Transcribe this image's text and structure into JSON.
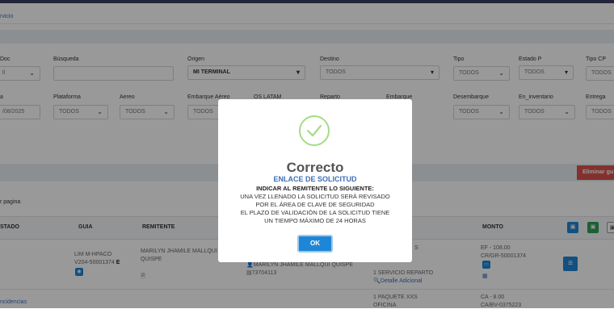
{
  "breadcrumb": "rvicio",
  "filters": {
    "row1": [
      {
        "label": "Doc",
        "value": "ll",
        "type": "select"
      },
      {
        "label": "Búsqueda",
        "value": "",
        "type": "input"
      },
      {
        "label": "Origen",
        "value": "MI TERMINAL",
        "type": "select"
      },
      {
        "label": "Destino",
        "value": "TODOS",
        "type": "select"
      },
      {
        "label": "Tipo",
        "value": "TODOS",
        "type": "select"
      },
      {
        "label": "Estado P",
        "value": "TODOS",
        "type": "select"
      },
      {
        "label": "Tipo CP",
        "value": "TODOS",
        "type": "select"
      }
    ],
    "row2": [
      {
        "label": "a",
        "value": "/08/2025"
      },
      {
        "label": "Plataforma",
        "value": "TODOS"
      },
      {
        "label": "Aereo",
        "value": "TODOS"
      },
      {
        "label": "Embarque Aéreo",
        "value": "TODOS"
      },
      {
        "label": "OS LATAM",
        "value": ""
      },
      {
        "label": "Reparto",
        "value": ""
      },
      {
        "label": "Embarque",
        "value": ""
      },
      {
        "label": "Desembarque",
        "value": "TODOS"
      },
      {
        "label": "En_inventario",
        "value": "TODOS"
      },
      {
        "label": "Entrega",
        "value": "TODOS"
      }
    ]
  },
  "delete_button": "Eliminar gu",
  "per_page": "r pagina",
  "table": {
    "headers": [
      "STADO",
      "GUIA",
      "REMITENTE",
      "MONTO"
    ],
    "row1": {
      "guia_1": "LIM M-HPACO",
      "guia_2": "V204-50001374",
      "guia_mark": "E",
      "remitente_1": "MARILYN JHAMILE MALLQUI",
      "remitente_2": "QUISPE",
      "dest_1": "MARILYN JHAMILE MALLQUI QUISPE",
      "dest_2": "73704113",
      "detail_s": "S",
      "detail_1": "1 SERVICIO REPARTO",
      "detail_link": "Detalle Adicional",
      "monto_1": "EF - 108.00",
      "monto_2": "CR/GR-50001374"
    },
    "row2": {
      "estado": "ncidencias",
      "detail_1": "1 PAQUETE XXS",
      "detail_2": "OFICINA",
      "monto_1": "CA - 8.00",
      "monto_2": "CA/BV-0375223"
    }
  },
  "modal": {
    "title": "Correcto",
    "subtitle": "ENLACE DE SOLICITUD",
    "instruction": "INDICAR AL REMITENTE LO SIGUIENTE:",
    "body": [
      "UNA VEZ LLENADO LA SOLICITUD SERÁ REVISADO",
      "POR EL ÁREA DE CLAVE DE SEGURIDAD",
      "EL PLAZO DE VALIDACIÓN DE LA SOLICITUD TIENE",
      "UN TIEMPO MÁXIMO DE 24 HORAS"
    ],
    "ok_label": "OK"
  },
  "colors": {
    "accent": "#1e86d6",
    "danger": "#d9534f",
    "success": "#a5dc86",
    "title_blue": "#3d6fb6"
  }
}
